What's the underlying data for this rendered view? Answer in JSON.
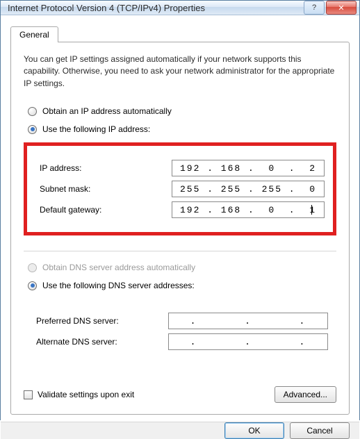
{
  "window": {
    "title": "Internet Protocol Version 4 (TCP/IPv4) Properties"
  },
  "tab": {
    "general": "General"
  },
  "description": "You can get IP settings assigned automatically if your network supports this capability. Otherwise, you need to ask your network administrator for the appropriate IP settings.",
  "ip": {
    "auto_label": "Obtain an IP address automatically",
    "manual_label": "Use the following IP address:",
    "fields": {
      "ip_label": "IP address:",
      "ip_value": "192 . 168 .  0  .  2",
      "subnet_label": "Subnet mask:",
      "subnet_value": "255 . 255 . 255 .  0",
      "gateway_label": "Default gateway:",
      "gateway_value": "192 . 168 .  0  .  1"
    }
  },
  "dns": {
    "auto_label": "Obtain DNS server address automatically",
    "manual_label": "Use the following DNS server addresses:",
    "fields": {
      "preferred_label": "Preferred DNS server:",
      "preferred_value": " .       .       . ",
      "alternate_label": "Alternate DNS server:",
      "alternate_value": " .       .       . "
    }
  },
  "validate_label": "Validate settings upon exit",
  "buttons": {
    "advanced": "Advanced...",
    "ok": "OK",
    "cancel": "Cancel"
  }
}
